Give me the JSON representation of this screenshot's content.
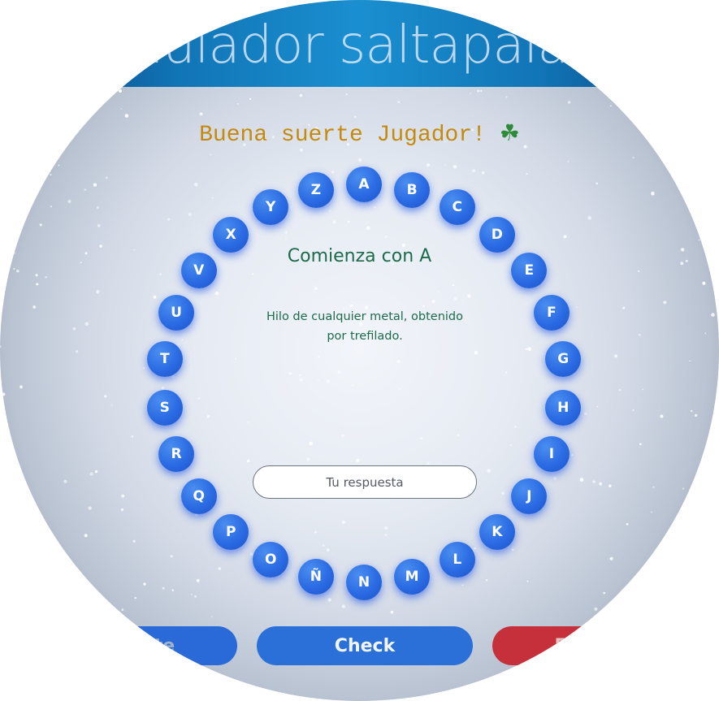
{
  "header": {
    "title": "Simulador saltapalabra"
  },
  "greeting": {
    "text": "Buena suerte Jugador!",
    "icon": "four-leaf-clover-icon",
    "icon_glyph": "☘"
  },
  "ring": {
    "letters": [
      "A",
      "B",
      "C",
      "D",
      "E",
      "F",
      "G",
      "H",
      "I",
      "J",
      "K",
      "L",
      "M",
      "N",
      "Ñ",
      "O",
      "P",
      "Q",
      "R",
      "S",
      "T",
      "U",
      "V",
      "X",
      "Y",
      "Z"
    ]
  },
  "question": {
    "prompt": "Comienza con A",
    "definition": "Hilo de cualquier metal, obtenido por trefilado."
  },
  "answer": {
    "placeholder": "Tu respuesta",
    "value": ""
  },
  "buttons": {
    "next": "Siguiente",
    "check": "Check",
    "end": "Fin juego"
  },
  "colors": {
    "letter_bubble": "#2a6ae3",
    "prompt_text": "#1d6b4a",
    "greeting_text": "#c58a0c",
    "check_button": "#2b6fd8",
    "end_button": "#c6303a"
  }
}
